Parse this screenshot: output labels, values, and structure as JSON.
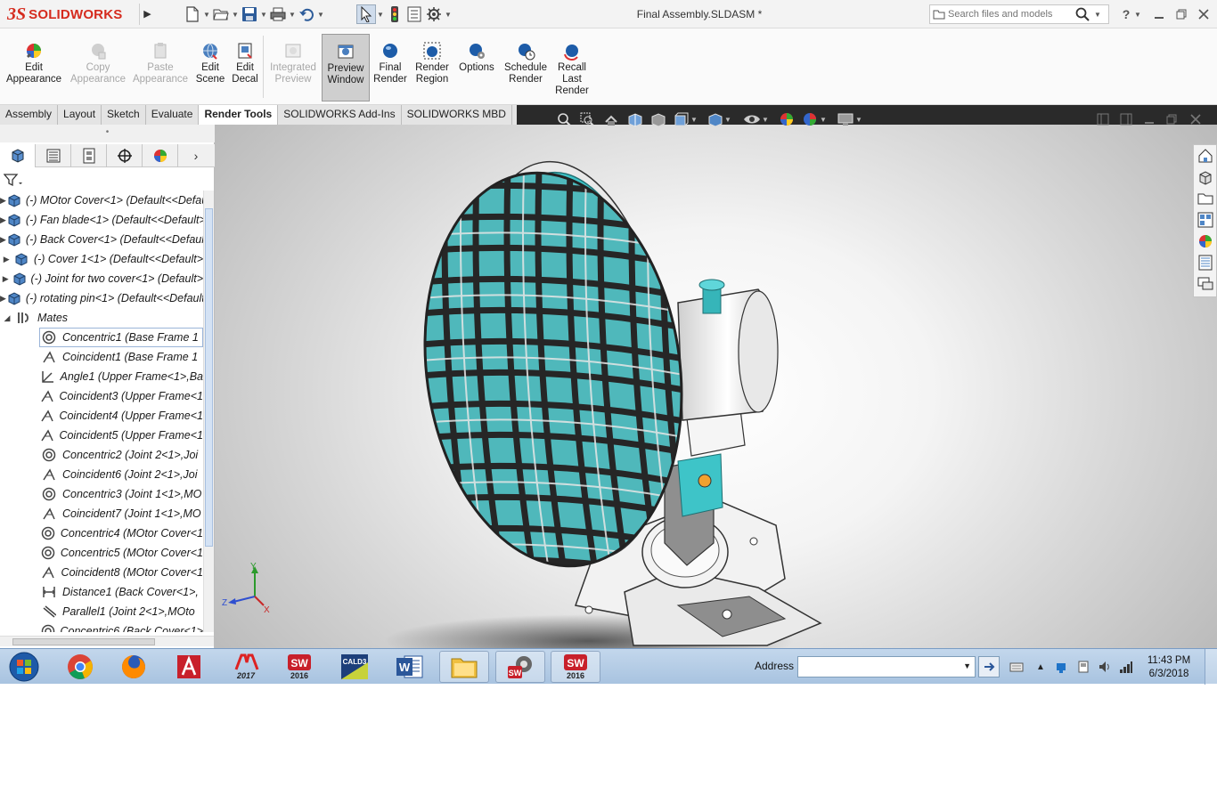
{
  "app": {
    "brand_ds": "3S",
    "brand_name": "SOLIDWORKS",
    "document_title": "Final Assembly.SLDASM *",
    "search_placeholder": "Search files and models"
  },
  "quick_access": [
    {
      "name": "new-document",
      "icon": "new-document-icon"
    },
    {
      "name": "open",
      "icon": "open-folder-icon"
    },
    {
      "name": "save",
      "icon": "save-icon"
    },
    {
      "name": "print",
      "icon": "print-icon"
    },
    {
      "name": "undo",
      "icon": "undo-icon"
    },
    {
      "name": "select",
      "icon": "select-arrow-icon"
    },
    {
      "name": "rebuild",
      "icon": "traffic-light-icon"
    },
    {
      "name": "file-properties",
      "icon": "file-properties-icon"
    },
    {
      "name": "options",
      "icon": "gear-icon"
    }
  ],
  "ribbon": {
    "buttons": [
      {
        "label_1": "Edit",
        "label_2": "Appearance",
        "enabled": true
      },
      {
        "label_1": "Copy",
        "label_2": "Appearance",
        "enabled": false
      },
      {
        "label_1": "Paste",
        "label_2": "Appearance",
        "enabled": false
      },
      {
        "label_1": "Edit",
        "label_2": "Scene",
        "enabled": true
      },
      {
        "label_1": "Edit",
        "label_2": "Decal",
        "enabled": true
      },
      {
        "label_1": "Integrated",
        "label_2": "Preview",
        "enabled": false
      },
      {
        "label_1": "Preview",
        "label_2": "Window",
        "enabled": true,
        "active": true
      },
      {
        "label_1": "Final",
        "label_2": "Render",
        "enabled": true
      },
      {
        "label_1": "Render",
        "label_2": "Region",
        "enabled": true
      },
      {
        "label_1": "Options",
        "label_2": "",
        "enabled": true
      },
      {
        "label_1": "Schedule",
        "label_2": "Render",
        "enabled": true
      },
      {
        "label_1": "Recall",
        "label_2": "Last",
        "label_3": "Render",
        "enabled": true
      }
    ]
  },
  "command_tabs": [
    "Assembly",
    "Layout",
    "Sketch",
    "Evaluate",
    "Render Tools",
    "SOLIDWORKS Add-Ins",
    "SOLIDWORKS MBD"
  ],
  "active_tab": "Render Tools",
  "feature_tree": {
    "components": [
      "(-) MOtor Cover<1> (Default<<Default>",
      "(-) Fan blade<1> (Default<<Default>",
      "(-) Back Cover<1> (Default<<Default>",
      "(-) Cover 1<1> (Default<<Default>",
      "(-) Joint for two cover<1> (Default>",
      "(-) rotating pin<1> (Default<<Default>"
    ],
    "mates_folder": "Mates",
    "mates": [
      {
        "label": "Concentric1 (Base Frame 1",
        "type": "concentric"
      },
      {
        "label": "Coincident1 (Base Frame 1",
        "type": "coincident"
      },
      {
        "label": "Angle1 (Upper Frame<1>,Ba",
        "type": "angle"
      },
      {
        "label": "Coincident3 (Upper Frame<1",
        "type": "coincident"
      },
      {
        "label": "Coincident4 (Upper Frame<1",
        "type": "coincident"
      },
      {
        "label": "Coincident5 (Upper Frame<1",
        "type": "coincident"
      },
      {
        "label": "Concentric2 (Joint 2<1>,Joi",
        "type": "concentric"
      },
      {
        "label": "Coincident6 (Joint 2<1>,Joi",
        "type": "coincident"
      },
      {
        "label": "Concentric3 (Joint 1<1>,MO",
        "type": "concentric"
      },
      {
        "label": "Coincident7 (Joint 1<1>,MO",
        "type": "coincident"
      },
      {
        "label": "Concentric4 (MOtor Cover<1",
        "type": "concentric"
      },
      {
        "label": "Concentric5 (MOtor Cover<1",
        "type": "concentric"
      },
      {
        "label": "Coincident8 (MOtor Cover<1",
        "type": "coincident"
      },
      {
        "label": "Distance1 (Back Cover<1>,",
        "type": "distance"
      },
      {
        "label": "Parallel1 (Joint 2<1>,MOto",
        "type": "parallel"
      },
      {
        "label": "Concentric6 (Back Cover<1>",
        "type": "concentric"
      }
    ]
  },
  "triad": {
    "y": "Y",
    "z": "Z",
    "x": "X"
  },
  "taskbar": {
    "apps": [
      {
        "name": "chrome",
        "icon": "chrome-icon"
      },
      {
        "name": "firefox",
        "icon": "firefox-icon"
      },
      {
        "name": "autocad",
        "icon": "autocad-icon"
      },
      {
        "name": "mastercam-2017",
        "icon": "mastercam-icon",
        "caption": "2017"
      },
      {
        "name": "solidworks-2016",
        "icon": "solidworks-icon",
        "caption": "2016"
      },
      {
        "name": "caldb",
        "icon": "caldb-icon",
        "caption": "CALD3"
      },
      {
        "name": "word",
        "icon": "word-icon",
        "caption": "W"
      },
      {
        "name": "explorer",
        "icon": "folder-icon"
      },
      {
        "name": "solidworks-launcher",
        "icon": "solidworks-launcher-icon"
      },
      {
        "name": "solidworks-2016-open",
        "icon": "solidworks-icon",
        "caption": "2016"
      }
    ],
    "address_label": "Address",
    "address_value": "",
    "clock_time": "11:43 PM",
    "clock_date": "6/3/2018"
  },
  "colors": {
    "brand_red": "#d52b1e",
    "fan_teal": "#3ec4c8",
    "grille_dark": "#2b2b2b",
    "taskbar_blue": "#b4cbe6"
  }
}
